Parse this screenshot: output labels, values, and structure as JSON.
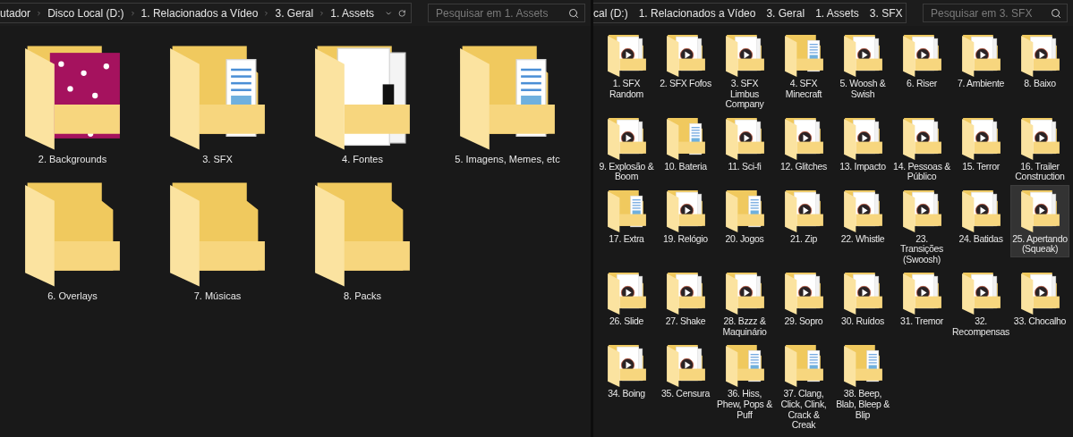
{
  "left_window": {
    "breadcrumb": [
      "utador",
      "Disco Local (D:)",
      "1. Relacionados a Vídeo",
      "3. Geral",
      "1. Assets"
    ],
    "search": {
      "placeholder": "Pesquisar em 1. Assets"
    },
    "items": [
      {
        "label": "2. Backgrounds",
        "kind": "pattern",
        "selected": false
      },
      {
        "label": "3. SFX",
        "kind": "docs",
        "selected": false
      },
      {
        "label": "4. Fontes",
        "kind": "font",
        "selected": false
      },
      {
        "label": "5. Imagens, Memes, etc",
        "kind": "docs",
        "selected": false
      },
      {
        "label": "6. Overlays",
        "kind": "plain",
        "selected": false
      },
      {
        "label": "7. Músicas",
        "kind": "plain",
        "selected": false
      },
      {
        "label": "8. Packs",
        "kind": "plain",
        "selected": false
      }
    ]
  },
  "right_window": {
    "breadcrumb": [
      "cal (D:)",
      "1. Relacionados a Vídeo",
      "3. Geral",
      "1. Assets",
      "3. SFX"
    ],
    "search": {
      "placeholder": "Pesquisar em 3. SFX"
    },
    "items": [
      {
        "label": "1. SFX Random",
        "kind": "media",
        "selected": false
      },
      {
        "label": "2. SFX Fofos",
        "kind": "media",
        "selected": false
      },
      {
        "label": "3. SFX Limbus Company",
        "kind": "media",
        "selected": false
      },
      {
        "label": "4. SFX Minecraft",
        "kind": "docs",
        "selected": false
      },
      {
        "label": "5. Woosh & Swish",
        "kind": "media",
        "selected": false
      },
      {
        "label": "6. Riser",
        "kind": "media",
        "selected": false
      },
      {
        "label": "7. Ambiente",
        "kind": "media",
        "selected": false
      },
      {
        "label": "8. Baixo",
        "kind": "media",
        "selected": false
      },
      {
        "label": "9. Explosão & Boom",
        "kind": "media",
        "selected": false
      },
      {
        "label": "10. Bateria",
        "kind": "docs",
        "selected": false
      },
      {
        "label": "11. Sci-fi",
        "kind": "media",
        "selected": false
      },
      {
        "label": "12. Glitches",
        "kind": "media",
        "selected": false
      },
      {
        "label": "13. Impacto",
        "kind": "media",
        "selected": false
      },
      {
        "label": "14. Pessoas & Público",
        "kind": "media",
        "selected": false
      },
      {
        "label": "15. Terror",
        "kind": "media",
        "selected": false
      },
      {
        "label": "16. Trailer Construction",
        "kind": "media",
        "selected": false
      },
      {
        "label": "17. Extra",
        "kind": "docs",
        "selected": false
      },
      {
        "label": "19. Relógio",
        "kind": "media",
        "selected": false
      },
      {
        "label": "20. Jogos",
        "kind": "docs",
        "selected": false
      },
      {
        "label": "21. Zip",
        "kind": "media",
        "selected": false
      },
      {
        "label": "22. Whistle",
        "kind": "media",
        "selected": false
      },
      {
        "label": "23. Transições (Swoosh)",
        "kind": "media",
        "selected": false
      },
      {
        "label": "24. Batidas",
        "kind": "media",
        "selected": false
      },
      {
        "label": "25. Apertando (Squeak)",
        "kind": "media",
        "selected": true
      },
      {
        "label": "26. Slide",
        "kind": "media",
        "selected": false
      },
      {
        "label": "27. Shake",
        "kind": "media",
        "selected": false
      },
      {
        "label": "28. Bzzz & Maquinário",
        "kind": "media",
        "selected": false
      },
      {
        "label": "29. Sopro",
        "kind": "media",
        "selected": false
      },
      {
        "label": "30. Ruídos",
        "kind": "media",
        "selected": false
      },
      {
        "label": "31. Tremor",
        "kind": "media",
        "selected": false
      },
      {
        "label": "32. Recompensas",
        "kind": "media",
        "selected": false
      },
      {
        "label": "33. Chocalho",
        "kind": "media",
        "selected": false
      },
      {
        "label": "34. Boing",
        "kind": "media",
        "selected": false
      },
      {
        "label": "35. Censura",
        "kind": "media",
        "selected": false
      },
      {
        "label": "36. Hiss, Phew, Pops & Puff",
        "kind": "docs",
        "selected": false
      },
      {
        "label": "37. Clang, Click, Clink, Crack & Creak",
        "kind": "docs",
        "selected": false
      },
      {
        "label": "38. Beep, Blab, Bleep & Blip",
        "kind": "docs",
        "selected": false
      }
    ]
  }
}
